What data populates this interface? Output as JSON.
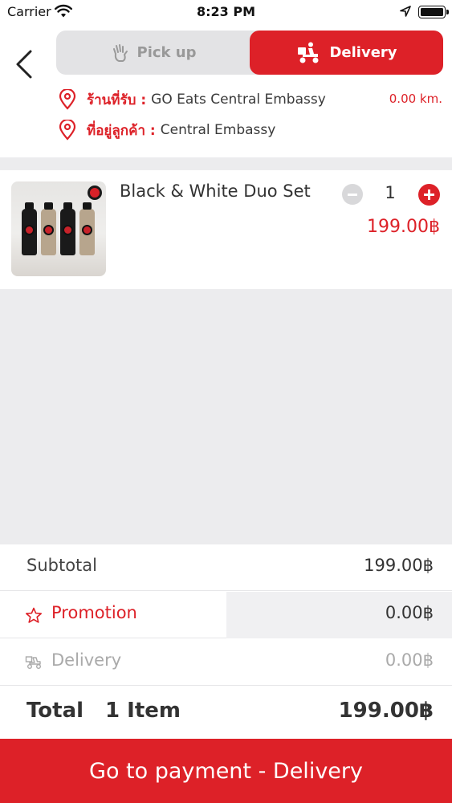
{
  "status_bar": {
    "carrier": "Carrier",
    "time": "8:23 PM"
  },
  "header": {
    "tabs": {
      "pickup": "Pick up",
      "delivery": "Delivery"
    },
    "store_label": "ร้านที่รับ :",
    "store_name": "GO Eats Central Embassy",
    "distance": "0.00 km.",
    "customer_label": "ที่อยู่ลูกค้า :",
    "customer_address": "Central Embassy"
  },
  "cart": {
    "items": [
      {
        "name": "Black & White Duo Set",
        "quantity": "1",
        "price": "199.00฿"
      }
    ]
  },
  "summary": {
    "subtotal_label": "Subtotal",
    "subtotal_value": "199.00฿",
    "promotion_label": "Promotion",
    "promotion_value": "0.00฿",
    "delivery_label": "Delivery",
    "delivery_value": "0.00฿",
    "total_label": "Total",
    "total_items": "1 Item",
    "total_value": "199.00฿"
  },
  "payment_button": "Go to payment - Delivery",
  "colors": {
    "accent": "#dd2128",
    "background": "#ececee",
    "muted": "#aaaaaa"
  },
  "icons": [
    "wifi-icon",
    "location-arrow-icon",
    "battery-icon",
    "back-chevron-icon",
    "hand-icon",
    "delivery-scooter-icon",
    "map-pin-icon",
    "minus-icon",
    "plus-icon",
    "star-icon"
  ]
}
